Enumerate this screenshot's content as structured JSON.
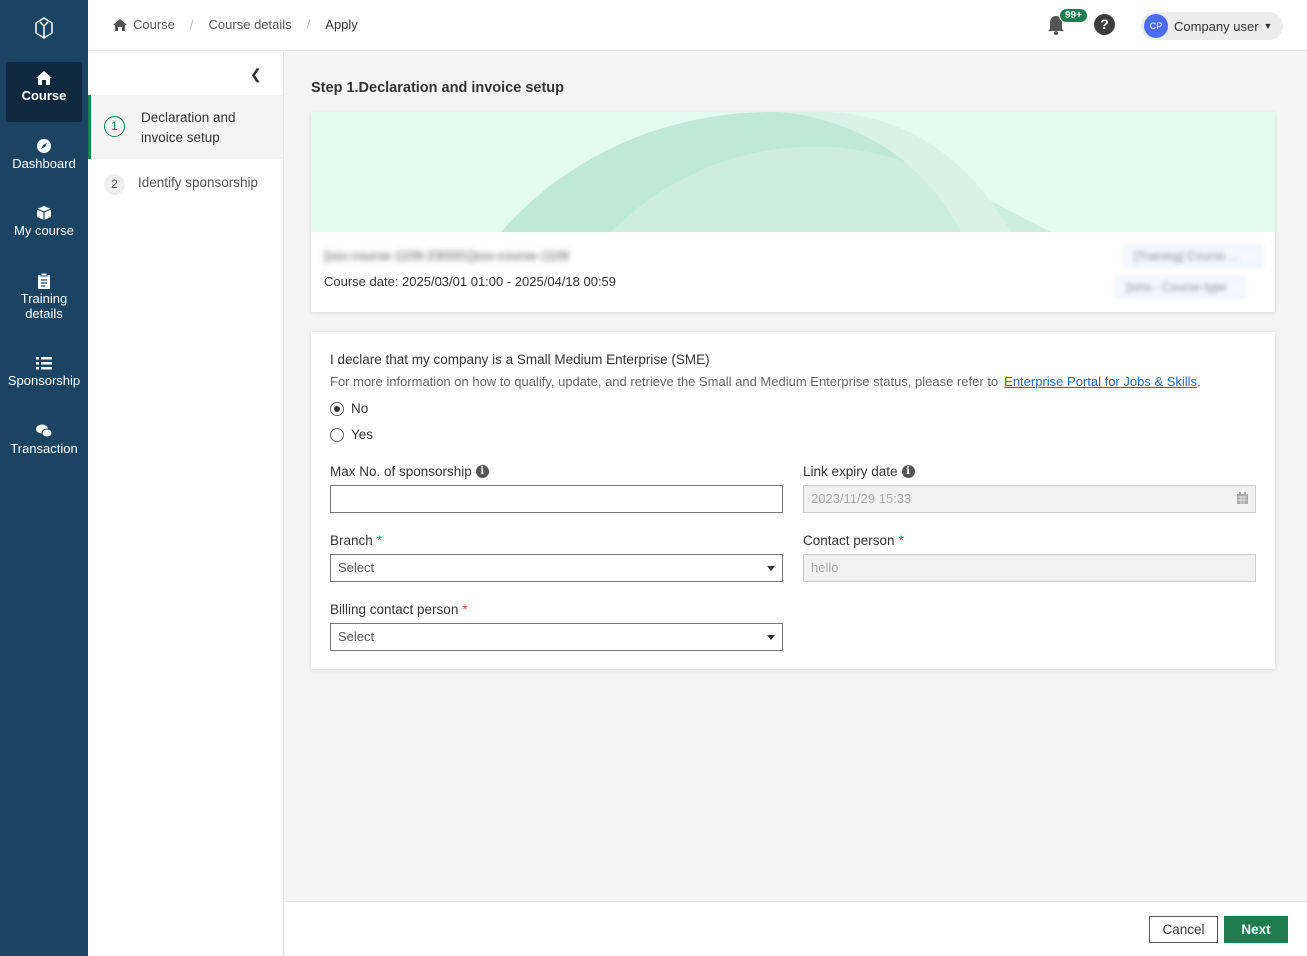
{
  "nav": {
    "items": [
      {
        "label": "Course",
        "icon": "home-icon"
      },
      {
        "label": "Dashboard",
        "icon": "compass-icon"
      },
      {
        "label": "My course",
        "icon": "box-icon"
      },
      {
        "label": "Training details",
        "icon": "clipboard-icon"
      },
      {
        "label": "Sponsorship",
        "icon": "list-icon"
      },
      {
        "label": "Transaction",
        "icon": "chat-icon"
      }
    ]
  },
  "breadcrumb": [
    "Course",
    "Course details",
    "Apply"
  ],
  "header": {
    "notif_badge": "99+",
    "help": "?",
    "user_initials": "CP",
    "user_name": "Company user"
  },
  "steps": [
    {
      "num": "1",
      "label": "Declaration and invoice setup"
    },
    {
      "num": "2",
      "label": "Identify sponsorship"
    }
  ],
  "main": {
    "title": "Step 1.Declaration and invoice setup",
    "course": {
      "name": "[sss-course-1109-230001]sss-course-1109",
      "date": "Course date: 2025/03/01 01:00 - 2025/04/18 00:59",
      "tag1": "[Training] Course ...",
      "tag2": "[sms - Course type"
    },
    "form": {
      "declaration": "I declare that my company is a Small Medium Enterprise (SME)",
      "info_text": "For more information on how to qualify, update, and retrieve the Small and Medium Enterprise status, please refer to",
      "info_link": "Enterprise Portal for Jobs & Skills",
      "info_tail": ".",
      "radio_no": "No",
      "radio_yes": "Yes",
      "max_label": "Max No. of sponsorship",
      "max_value": "",
      "expiry_label": "Link expiry date",
      "expiry_value": "2023/11/29 15:33",
      "branch_label": "Branch",
      "branch_value": "Select",
      "contact_label": "Contact person",
      "contact_value": "hello",
      "billing_label": "Billing contact person",
      "billing_value": "Select",
      "required_mark": "*",
      "info_icon": "i"
    }
  },
  "footer": {
    "cancel": "Cancel",
    "next": "Next"
  },
  "colors": {
    "nav_bg": "#1b4462",
    "accent": "#1d7d4f",
    "link": "#2766b3"
  }
}
